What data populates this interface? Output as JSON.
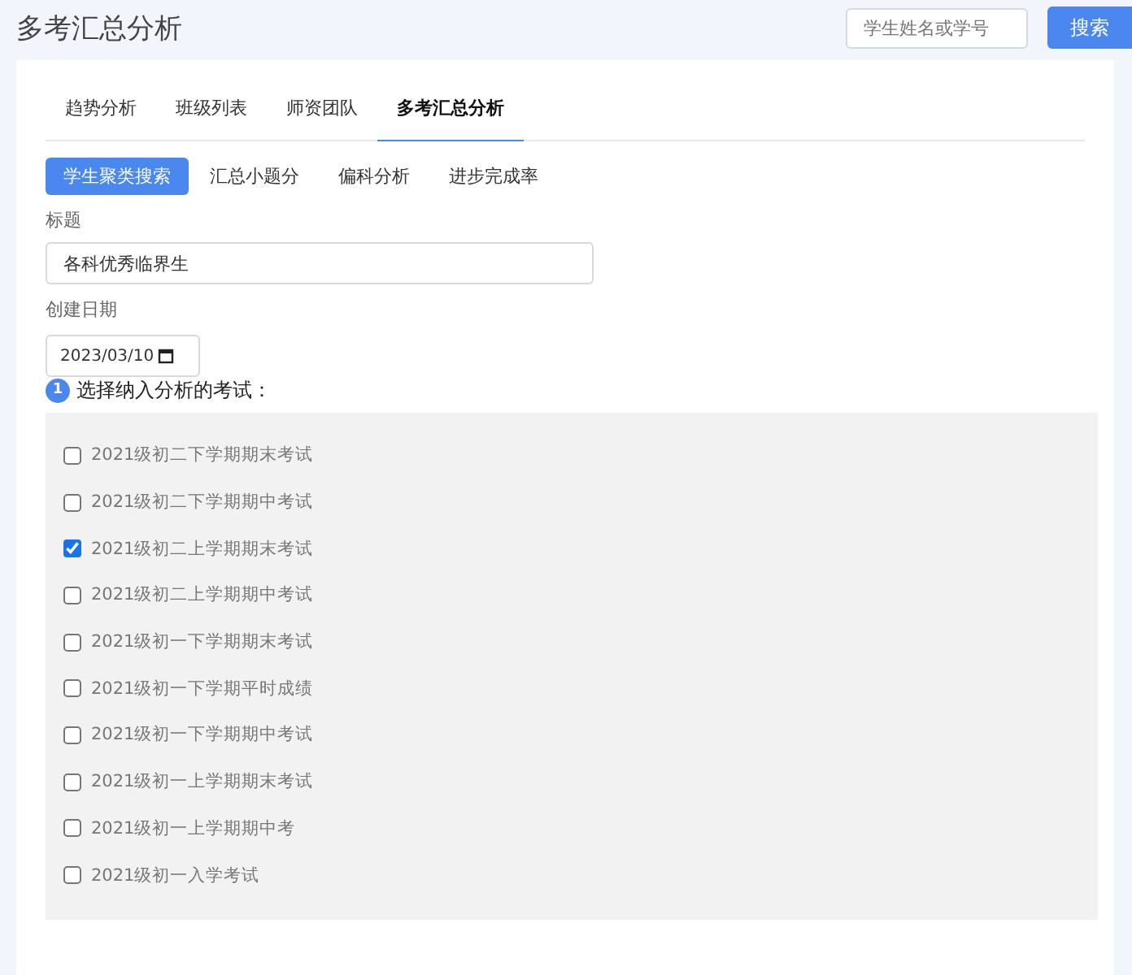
{
  "page_title": "多考汇总分析",
  "search": {
    "placeholder": "学生姓名或学号",
    "button": "搜索"
  },
  "tabs": [
    {
      "label": "趋势分析",
      "selected": false
    },
    {
      "label": "班级列表",
      "selected": false
    },
    {
      "label": "师资团队",
      "selected": false
    },
    {
      "label": "多考汇总分析",
      "selected": true
    }
  ],
  "subtabs": [
    {
      "label": "学生聚类搜索",
      "selected": true
    },
    {
      "label": "汇总小题分",
      "selected": false
    },
    {
      "label": "偏科分析",
      "selected": false
    },
    {
      "label": "进步完成率",
      "selected": false
    }
  ],
  "form": {
    "title_label": "标题",
    "title_value": "各科优秀临界生",
    "date_label": "创建日期",
    "date_value": "2023/03/10"
  },
  "step": {
    "number": "1",
    "label": "选择纳入分析的考试："
  },
  "exams": [
    {
      "label": "2021级初二下学期期末考试",
      "checked": false
    },
    {
      "label": "2021级初二下学期期中考试",
      "checked": false
    },
    {
      "label": "2021级初二上学期期末考试",
      "checked": true
    },
    {
      "label": "2021级初二上学期期中考试",
      "checked": false
    },
    {
      "label": "2021级初一下学期期末考试",
      "checked": false
    },
    {
      "label": "2021级初一下学期平时成绩",
      "checked": false
    },
    {
      "label": "2021级初一下学期期中考试",
      "checked": false
    },
    {
      "label": "2021级初一上学期期末考试",
      "checked": false
    },
    {
      "label": "2021级初一上学期期中考",
      "checked": false
    },
    {
      "label": "2021级初一入学考试",
      "checked": false
    }
  ]
}
